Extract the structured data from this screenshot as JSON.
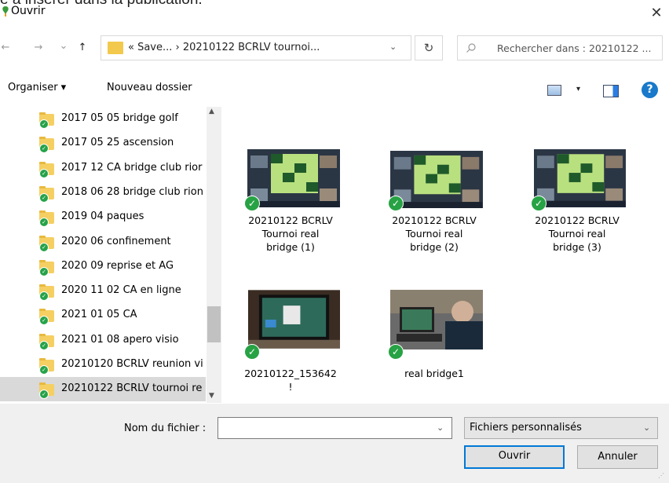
{
  "background_text": "e à insérer dans la publication.",
  "window": {
    "title": "Ouvrir",
    "close": "✕"
  },
  "nav": {
    "back": "←",
    "forward": "→",
    "recent": "⌄",
    "up": "↑",
    "address": "«  Save...  ›  20210122 BCRLV tournoi...",
    "address_dd": "⌄",
    "refresh": "↻",
    "search_placeholder": "Rechercher dans : 20210122 ..."
  },
  "toolbar": {
    "organise": "Organiser ▾",
    "new_folder": "Nouveau dossier",
    "view_dd": "▾",
    "help": "?"
  },
  "tree": {
    "items": [
      {
        "label": "2017 05 05 bridge golf"
      },
      {
        "label": "2017 05 25 ascension"
      },
      {
        "label": "2017 12 CA bridge club rior"
      },
      {
        "label": "2018 06 28 bridge club rion"
      },
      {
        "label": "2019 04 paques"
      },
      {
        "label": "2020 06 confinement"
      },
      {
        "label": "2020 09 reprise et AG"
      },
      {
        "label": "2020 11 02 CA en ligne"
      },
      {
        "label": "2021 01 05 CA"
      },
      {
        "label": "2021 01 08 apero visio"
      },
      {
        "label": "20210120 BCRLV reunion vi"
      },
      {
        "label": "20210122 BCRLV tournoi re"
      }
    ],
    "scroll_up": "▲",
    "scroll_down": "▼"
  },
  "files": [
    {
      "name": "20210122 BCRLV\nTournoi real\nbridge (1)"
    },
    {
      "name": "20210122 BCRLV\nTournoi real\nbridge (2)"
    },
    {
      "name": "20210122 BCRLV\nTournoi real\nbridge (3)"
    },
    {
      "name": "20210122_153642\n!"
    },
    {
      "name": "real bridge1"
    }
  ],
  "bottom": {
    "filename_label": "Nom du fichier :",
    "filename_value": "",
    "filename_dd": "⌄",
    "filetype": "Fichiers personnalisés",
    "filetype_dd": "⌄",
    "open": "Ouvrir",
    "cancel": "Annuler"
  },
  "colors": {
    "check": "#27a244",
    "folder": "#f5cf62",
    "accent": "#0078d7"
  }
}
